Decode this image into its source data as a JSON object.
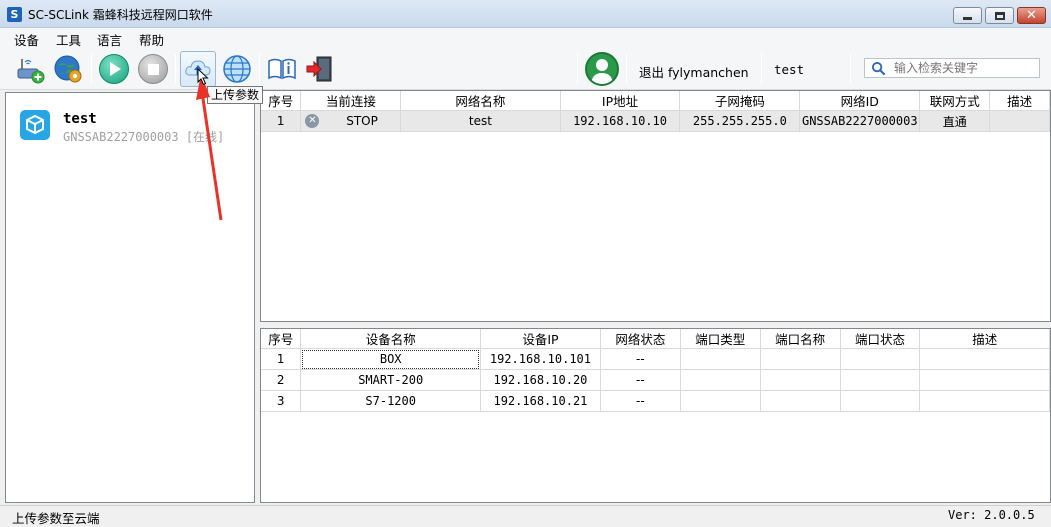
{
  "window": {
    "title": "SC-SCLink 霜蜂科技远程网口软件",
    "app_icon_letter": "S"
  },
  "menu": {
    "items": [
      "设备",
      "工具",
      "语言",
      "帮助"
    ]
  },
  "toolbar": {
    "buttons": [
      {
        "icon": "add-device-icon"
      },
      {
        "icon": "network-settings-icon"
      },
      {
        "icon": "play-icon"
      },
      {
        "icon": "stop-icon"
      },
      {
        "icon": "upload-cloud-icon",
        "active": true
      },
      {
        "icon": "globe-icon"
      },
      {
        "icon": "manual-book-icon"
      },
      {
        "icon": "exit-door-icon"
      }
    ],
    "tooltip": "上传参数",
    "logout_label": "退出 fylymanchen",
    "current_user": "test",
    "search_placeholder": "输入检索关键字"
  },
  "device_list": {
    "items": [
      {
        "name": "test",
        "subtitle": "GNSSAB2227000003 [在线]"
      }
    ]
  },
  "network_table": {
    "columns": [
      "序号",
      "当前连接",
      "网络名称",
      "IP地址",
      "子网掩码",
      "网络ID",
      "联网方式",
      "描述"
    ],
    "rows": [
      {
        "index": "1",
        "connection": "STOP",
        "name": "test",
        "ip": "192.168.10.10",
        "mask": "255.255.255.0",
        "network_id": "GNSSAB2227000003",
        "mode": "直通",
        "desc": ""
      }
    ]
  },
  "device_table": {
    "columns": [
      "序号",
      "设备名称",
      "设备IP",
      "网络状态",
      "端口类型",
      "端口名称",
      "端口状态",
      "描述"
    ],
    "rows": [
      {
        "index": "1",
        "name": "BOX",
        "ip": "192.168.10.101",
        "status": "--",
        "port_type": "",
        "port_name": "",
        "port_status": "",
        "desc": ""
      },
      {
        "index": "2",
        "name": "SMART-200",
        "ip": "192.168.10.20",
        "status": "--",
        "port_type": "",
        "port_name": "",
        "port_status": "",
        "desc": ""
      },
      {
        "index": "3",
        "name": "S7-1200",
        "ip": "192.168.10.21",
        "status": "--",
        "port_type": "",
        "port_name": "",
        "port_status": "",
        "desc": ""
      }
    ]
  },
  "statusbar": {
    "message": "上传参数至云端",
    "version": "Ver: 2.0.0.5"
  },
  "colors": {
    "accent": "#27a6e5",
    "annotation_arrow": "#e8332a"
  }
}
